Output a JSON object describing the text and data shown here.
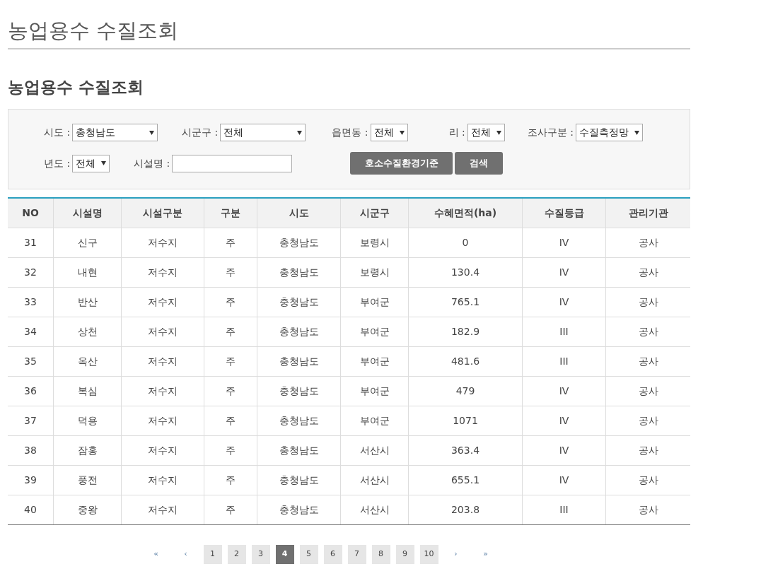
{
  "page_title": "농업용수 수질조회",
  "section_title": "농업용수 수질조회",
  "filters": {
    "row_1": [
      {
        "kind": "select",
        "label": "시도 :",
        "value": "충청남도"
      },
      {
        "kind": "select",
        "label": "시군구 :",
        "value": "전체"
      },
      {
        "kind": "select",
        "label": "읍면동 :",
        "value": "전체"
      },
      {
        "kind": "select",
        "label": "리 :",
        "value": "전체"
      },
      {
        "kind": "select",
        "label": "조사구분 :",
        "value": "수질측정망"
      }
    ],
    "row_2": [
      {
        "kind": "select",
        "label": "년도 :",
        "value": "전체"
      },
      {
        "kind": "input",
        "label": "시설명 :"
      }
    ],
    "buttons": [
      "호소수질환경기준",
      "검색"
    ]
  },
  "table": {
    "columns": [
      "NO",
      "시설명",
      "시설구분",
      "구분",
      "시도",
      "시군구",
      "수혜면적(ha)",
      "수질등급",
      "관리기관"
    ],
    "rows": [
      [
        "31",
        "신구",
        "저수지",
        "주",
        "충청남도",
        "보령시",
        "0",
        "IV",
        "공사"
      ],
      [
        "32",
        "내현",
        "저수지",
        "주",
        "충청남도",
        "보령시",
        "130.4",
        "IV",
        "공사"
      ],
      [
        "33",
        "반산",
        "저수지",
        "주",
        "충청남도",
        "부여군",
        "765.1",
        "IV",
        "공사"
      ],
      [
        "34",
        "상천",
        "저수지",
        "주",
        "충청남도",
        "부여군",
        "182.9",
        "III",
        "공사"
      ],
      [
        "35",
        "옥산",
        "저수지",
        "주",
        "충청남도",
        "부여군",
        "481.6",
        "III",
        "공사"
      ],
      [
        "36",
        "복심",
        "저수지",
        "주",
        "충청남도",
        "부여군",
        "479",
        "IV",
        "공사"
      ],
      [
        "37",
        "덕용",
        "저수지",
        "주",
        "충청남도",
        "부여군",
        "1071",
        "IV",
        "공사"
      ],
      [
        "38",
        "잠홍",
        "저수지",
        "주",
        "충청남도",
        "서산시",
        "363.4",
        "IV",
        "공사"
      ],
      [
        "39",
        "풍전",
        "저수지",
        "주",
        "충청남도",
        "서산시",
        "655.1",
        "IV",
        "공사"
      ],
      [
        "40",
        "중왕",
        "저수지",
        "주",
        "충청남도",
        "서산시",
        "203.8",
        "III",
        "공사"
      ]
    ]
  },
  "pagination": {
    "first": "«",
    "prev": "‹",
    "pages": [
      {
        "label": "1",
        "selected": false
      },
      {
        "label": "2",
        "selected": false
      },
      {
        "label": "3",
        "selected": false
      },
      {
        "label": "4",
        "selected": true
      },
      {
        "label": "5",
        "selected": false
      },
      {
        "label": "6",
        "selected": false
      },
      {
        "label": "7",
        "selected": false
      },
      {
        "label": "8",
        "selected": false
      },
      {
        "label": "9",
        "selected": false
      },
      {
        "label": "10",
        "selected": false
      }
    ],
    "next": "›",
    "last": "»"
  }
}
